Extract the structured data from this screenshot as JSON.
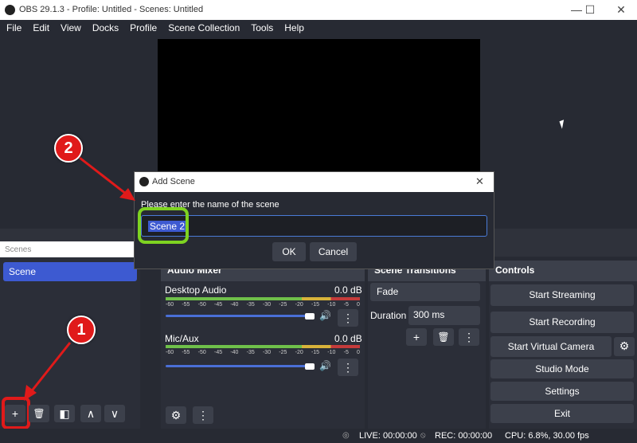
{
  "window": {
    "title": "OBS 29.1.3 - Profile: Untitled - Scenes: Untitled",
    "minimize": "—",
    "maximize": "☐",
    "close": "✕"
  },
  "menu": [
    "File",
    "Edit",
    "View",
    "Docks",
    "Profile",
    "Scene Collection",
    "Tools",
    "Help"
  ],
  "scenes_dock": {
    "title": "Scenes",
    "items": [
      "Scene"
    ],
    "selected_index": 0,
    "toolbar": {
      "add": "+",
      "remove": "🗑",
      "filters": "◧",
      "up": "∧",
      "down": "∨"
    }
  },
  "audio_mixer": {
    "title": "Audio Mixer",
    "scale": [
      "-60",
      "-55",
      "-50",
      "-45",
      "-40",
      "-35",
      "-30",
      "-25",
      "-20",
      "-15",
      "-10",
      "-5",
      "0"
    ],
    "channels": [
      {
        "name": "Desktop Audio",
        "level": "0.0 dB",
        "volume": 0.95
      },
      {
        "name": "Mic/Aux",
        "level": "0.0 dB",
        "volume": 0.95
      }
    ],
    "settings_icon": "⚙",
    "menu_icon": "⋮"
  },
  "transitions": {
    "title": "Scene Transitions",
    "selected": "Fade",
    "duration_label": "Duration",
    "duration_value": "300 ms",
    "add": "+",
    "remove": "🗑",
    "menu": "⋮"
  },
  "controls": {
    "title": "Controls",
    "buttons": [
      "Start Streaming",
      "Start Recording",
      "Start Virtual Camera",
      "Studio Mode",
      "Settings",
      "Exit"
    ],
    "gear": "⚙"
  },
  "dialog": {
    "title": "Add Scene",
    "prompt": "Please enter the name of the scene",
    "value": "Scene 2",
    "ok": "OK",
    "cancel": "Cancel",
    "close": "✕"
  },
  "callouts": [
    "1",
    "2"
  ],
  "status": {
    "live": "LIVE: 00:00:00",
    "rec": "REC: 00:00:00",
    "cpu": "CPU: 6.8%, 30.00 fps"
  },
  "colors": {
    "accent": "#3d5ad1",
    "callout_red": "#e01a1a",
    "highlight_green": "#7ed321"
  }
}
